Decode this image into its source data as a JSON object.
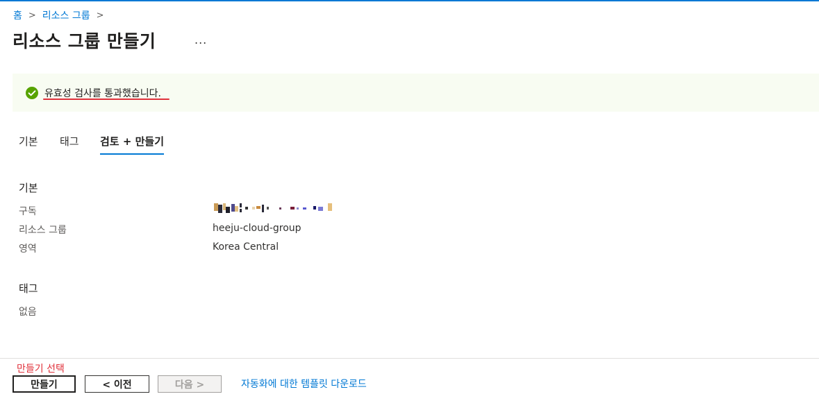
{
  "breadcrumb": {
    "home": "홈",
    "resource_groups": "리소스 그룹"
  },
  "page": {
    "title": "리소스 그룹 만들기",
    "more": "..."
  },
  "banner": {
    "message": "유효성 검사를 통과했습니다."
  },
  "tabs": [
    {
      "label": "기본"
    },
    {
      "label": "태그"
    },
    {
      "label": "검토 + 만들기"
    }
  ],
  "basics": {
    "heading": "기본",
    "subscription_label": "구독",
    "resource_group_label": "리소스 그룹",
    "resource_group_value": "heeju-cloud-group",
    "region_label": "영역",
    "region_value": "Korea Central"
  },
  "tags": {
    "heading": "태그",
    "none": "없음"
  },
  "annotation": "만들기 선택",
  "footer": {
    "create": "만들기",
    "prev": "< 이전",
    "next": "다음 >",
    "download_template": "자동화에 대한 템플릿 다운로드"
  },
  "colors": {
    "accent": "#0078d4",
    "success": "#57a300",
    "annotation_red": "#e0303a"
  }
}
